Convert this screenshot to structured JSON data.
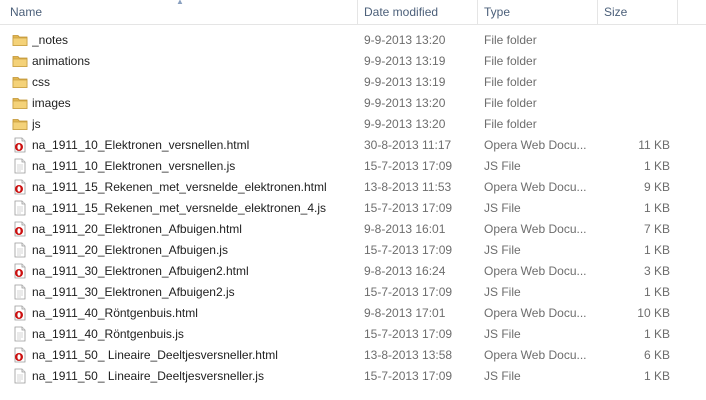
{
  "columns": {
    "name": "Name",
    "date_modified": "Date modified",
    "type": "Type",
    "size": "Size"
  },
  "files": [
    {
      "name": "_notes",
      "date": "9-9-2013 13:20",
      "type": "File folder",
      "size": "",
      "icon": "folder-icon"
    },
    {
      "name": "animations",
      "date": "9-9-2013 13:19",
      "type": "File folder",
      "size": "",
      "icon": "folder-icon"
    },
    {
      "name": "css",
      "date": "9-9-2013 13:19",
      "type": "File folder",
      "size": "",
      "icon": "folder-icon"
    },
    {
      "name": "images",
      "date": "9-9-2013 13:20",
      "type": "File folder",
      "size": "",
      "icon": "folder-icon"
    },
    {
      "name": "js",
      "date": "9-9-2013 13:20",
      "type": "File folder",
      "size": "",
      "icon": "folder-icon"
    },
    {
      "name": "na_1911_10_Elektronen_versnellen.html",
      "date": "30-8-2013 11:17",
      "type": "Opera Web Docu...",
      "size": "11 KB",
      "icon": "opera-html-icon"
    },
    {
      "name": "na_1911_10_Elektronen_versnellen.js",
      "date": "15-7-2013 17:09",
      "type": "JS File",
      "size": "1 KB",
      "icon": "js-file-icon"
    },
    {
      "name": "na_1911_15_Rekenen_met_versnelde_elektronen.html",
      "date": "13-8-2013 11:53",
      "type": "Opera Web Docu...",
      "size": "9 KB",
      "icon": "opera-html-icon"
    },
    {
      "name": "na_1911_15_Rekenen_met_versnelde_elektronen_4.js",
      "date": "15-7-2013 17:09",
      "type": "JS File",
      "size": "1 KB",
      "icon": "js-file-icon"
    },
    {
      "name": "na_1911_20_Elektronen_Afbuigen.html",
      "date": "9-8-2013 16:01",
      "type": "Opera Web Docu...",
      "size": "7 KB",
      "icon": "opera-html-icon"
    },
    {
      "name": "na_1911_20_Elektronen_Afbuigen.js",
      "date": "15-7-2013 17:09",
      "type": "JS File",
      "size": "1 KB",
      "icon": "js-file-icon"
    },
    {
      "name": "na_1911_30_Elektronen_Afbuigen2.html",
      "date": "9-8-2013 16:24",
      "type": "Opera Web Docu...",
      "size": "3 KB",
      "icon": "opera-html-icon"
    },
    {
      "name": "na_1911_30_Elektronen_Afbuigen2.js",
      "date": "15-7-2013 17:09",
      "type": "JS File",
      "size": "1 KB",
      "icon": "js-file-icon"
    },
    {
      "name": "na_1911_40_Röntgenbuis.html",
      "date": "9-8-2013 17:01",
      "type": "Opera Web Docu...",
      "size": "10 KB",
      "icon": "opera-html-icon"
    },
    {
      "name": "na_1911_40_Röntgenbuis.js",
      "date": "15-7-2013 17:09",
      "type": "JS File",
      "size": "1 KB",
      "icon": "js-file-icon"
    },
    {
      "name": "na_1911_50_ Lineaire_Deeltjesversneller.html",
      "date": "13-8-2013 13:58",
      "type": "Opera Web Docu...",
      "size": "6 KB",
      "icon": "opera-html-icon"
    },
    {
      "name": "na_1911_50_ Lineaire_Deeltjesversneller.js",
      "date": "15-7-2013 17:09",
      "type": "JS File",
      "size": "1 KB",
      "icon": "js-file-icon"
    }
  ]
}
